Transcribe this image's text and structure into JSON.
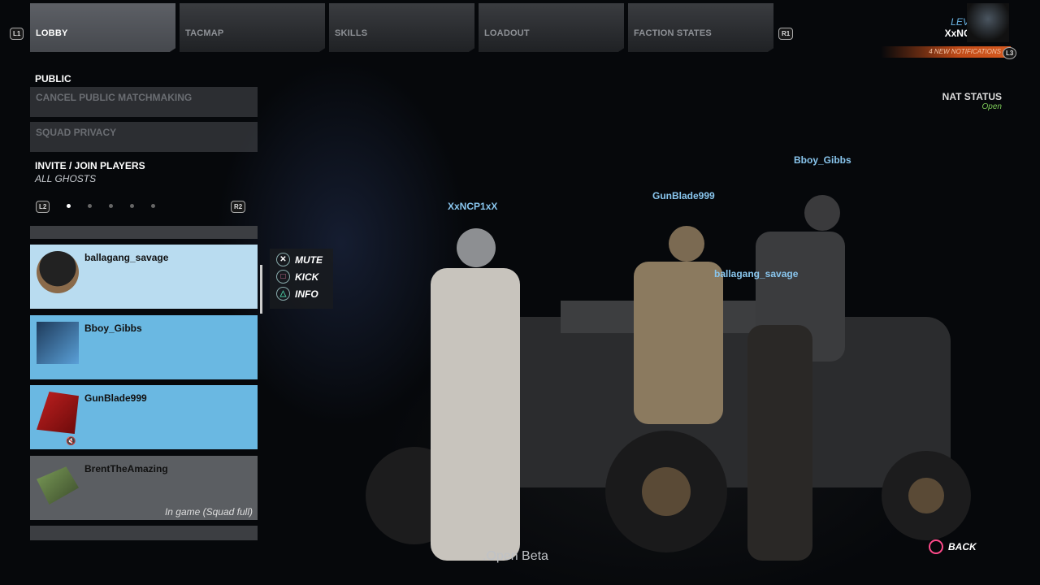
{
  "tabs": [
    {
      "label": "LOBBY"
    },
    {
      "label": "TACMAP"
    },
    {
      "label": "SKILLS"
    },
    {
      "label": "LOADOUT"
    },
    {
      "label": "FACTION STATES"
    }
  ],
  "buttons": {
    "l1": "L1",
    "r1": "R1",
    "l2": "L2",
    "r2": "R2",
    "l3": "L3"
  },
  "profile": {
    "level": "LEVEL 01",
    "name": "XxNCP1xX",
    "notifications": "4 NEW NOTIFICATIONS"
  },
  "left": {
    "section": "PUBLIC",
    "menu": [
      "CANCEL PUBLIC MATCHMAKING",
      "SQUAD PRIVACY"
    ],
    "invite_title": "INVITE / JOIN PLAYERS",
    "invite_sub": "ALL GHOSTS",
    "pages": 5,
    "current_page": 1
  },
  "players": [
    {
      "name": "ballagang_savage",
      "status": ""
    },
    {
      "name": "Bboy_Gibbs",
      "status": ""
    },
    {
      "name": "GunBlade999",
      "status": ""
    },
    {
      "name": "BrentTheAmazing",
      "status": "In game (Squad full)"
    }
  ],
  "context": {
    "mute": "MUTE",
    "kick": "KICK",
    "info": "INFO"
  },
  "scene_tags": [
    "XxNCP1xX",
    "GunBlade999",
    "Bboy_Gibbs",
    "ballagang_savage"
  ],
  "nat": {
    "title": "NAT STATUS",
    "value": "Open"
  },
  "footer": {
    "beta": ".Open Beta",
    "back": "BACK"
  },
  "colors": {
    "accent_blue": "#89c6ee",
    "notif_orange": "#d65a20",
    "nat_green": "#7fcf5a",
    "back_pink": "#ff4a8a"
  }
}
